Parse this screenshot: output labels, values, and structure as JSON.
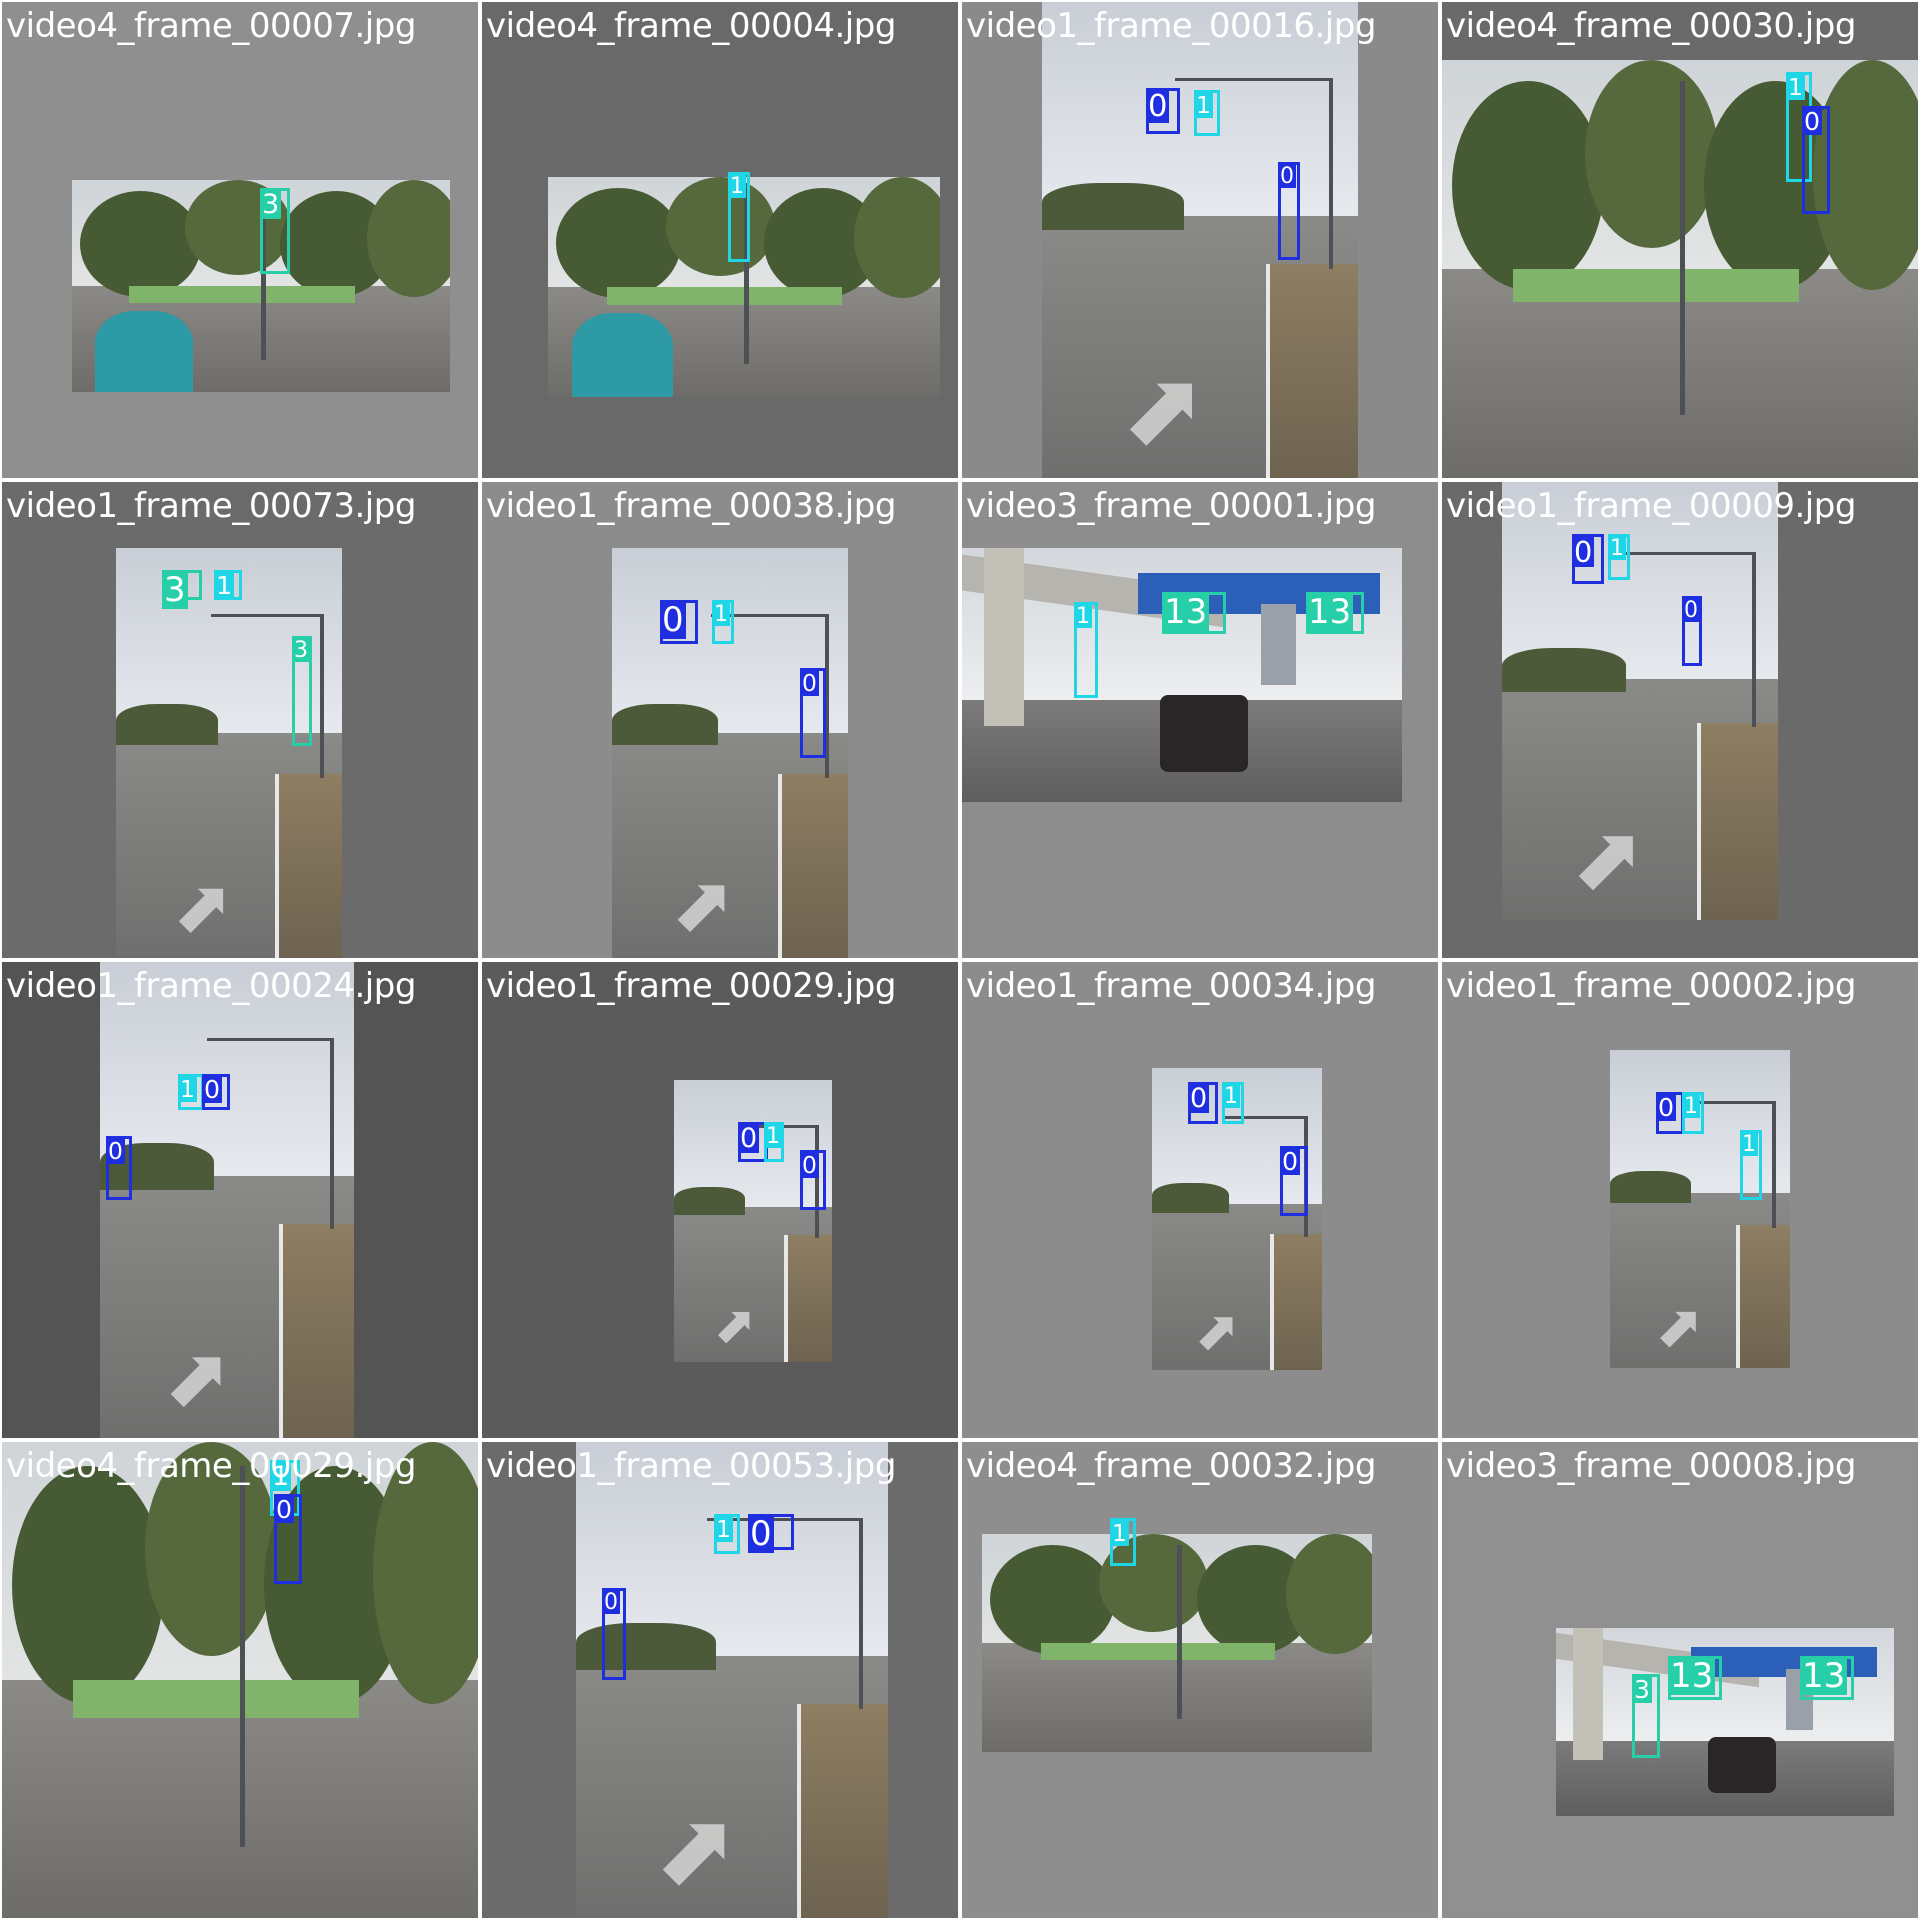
{
  "class_colors": {
    "0": "#1f2fe0",
    "1": "#1fd6e6",
    "3": "#26cfa8",
    "13": "#26cfa8"
  },
  "tiles": [
    {
      "name": "video4_frame_00007.jpg",
      "bg": "#8f8f8f",
      "scene": "bike",
      "detections": [
        {
          "label": "3"
        }
      ]
    },
    {
      "name": "video4_frame_00004.jpg",
      "bg": "#696969",
      "scene": "bike",
      "detections": [
        {
          "label": "1"
        }
      ]
    },
    {
      "name": "video1_frame_00016.jpg",
      "bg": "#8a8a8a",
      "scene": "road",
      "detections": [
        {
          "label": "0"
        },
        {
          "label": "1"
        },
        {
          "label": "0"
        }
      ]
    },
    {
      "name": "video4_frame_00030.jpg",
      "bg": "#6a6a6a",
      "scene": "trees",
      "detections": [
        {
          "label": "1"
        },
        {
          "label": "0"
        }
      ]
    },
    {
      "name": "video1_frame_00073.jpg",
      "bg": "#6b6b6b",
      "scene": "road",
      "detections": [
        {
          "label": "3"
        },
        {
          "label": "1"
        },
        {
          "label": "3"
        }
      ]
    },
    {
      "name": "video1_frame_00038.jpg",
      "bg": "#8c8c8c",
      "scene": "road",
      "detections": [
        {
          "label": "0"
        },
        {
          "label": "1"
        },
        {
          "label": "0"
        }
      ]
    },
    {
      "name": "video3_frame_00001.jpg",
      "bg": "#8d8d8d",
      "scene": "overpass",
      "detections": [
        {
          "label": "1"
        },
        {
          "label": "13"
        },
        {
          "label": "13"
        }
      ]
    },
    {
      "name": "video1_frame_00009.jpg",
      "bg": "#6a6a6a",
      "scene": "road",
      "detections": [
        {
          "label": "0"
        },
        {
          "label": "1"
        },
        {
          "label": "0"
        }
      ]
    },
    {
      "name": "video1_frame_00024.jpg",
      "bg": "#545454",
      "scene": "road",
      "detections": [
        {
          "label": "1"
        },
        {
          "label": "0"
        },
        {
          "label": "0"
        }
      ]
    },
    {
      "name": "video1_frame_00029.jpg",
      "bg": "#5b5b5b",
      "scene": "road",
      "detections": [
        {
          "label": "0"
        },
        {
          "label": "1"
        },
        {
          "label": "0"
        }
      ]
    },
    {
      "name": "video1_frame_00034.jpg",
      "bg": "#8c8c8c",
      "scene": "road",
      "detections": [
        {
          "label": "0"
        },
        {
          "label": "1"
        },
        {
          "label": "0"
        }
      ]
    },
    {
      "name": "video1_frame_00002.jpg",
      "bg": "#8c8c8c",
      "scene": "road",
      "detections": [
        {
          "label": "0"
        },
        {
          "label": "1"
        },
        {
          "label": "1"
        }
      ]
    },
    {
      "name": "video4_frame_00029.jpg",
      "bg": "#6a6a6a",
      "scene": "trees",
      "detections": [
        {
          "label": "1"
        },
        {
          "label": "0"
        }
      ]
    },
    {
      "name": "video1_frame_00053.jpg",
      "bg": "#6b6b6b",
      "scene": "road",
      "detections": [
        {
          "label": "1"
        },
        {
          "label": "0"
        },
        {
          "label": "0"
        }
      ]
    },
    {
      "name": "video4_frame_00032.jpg",
      "bg": "#8e8e8e",
      "scene": "trees",
      "detections": [
        {
          "label": "1"
        }
      ]
    },
    {
      "name": "video3_frame_00008.jpg",
      "bg": "#909090",
      "scene": "overpass",
      "detections": [
        {
          "label": "3"
        },
        {
          "label": "13"
        },
        {
          "label": "13"
        }
      ]
    }
  ]
}
